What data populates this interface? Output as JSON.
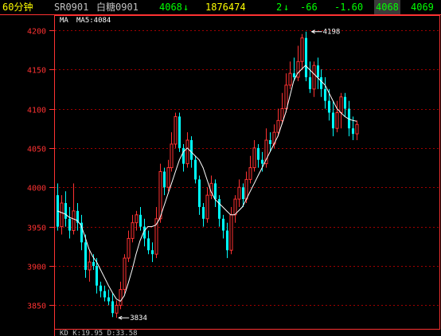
{
  "header": {
    "period": "60分钟",
    "contract_code": "SR0901",
    "contract_name": "白糖0901",
    "last_price": "4068",
    "last_arrow": "↓",
    "volume": "1876474",
    "tick_count": "2",
    "tick_arrow": "↓",
    "change": "-66",
    "change_pct": "-1.60",
    "bid": "4068",
    "ask": "4069"
  },
  "indicator_line": {
    "label": "MA",
    "ma5": "MA5:4084"
  },
  "bottom_indicator": {
    "text": "KD  K:19.95  D:33.58"
  },
  "colors": {
    "up": "#ff3232",
    "down": "#00ffff",
    "ma": "#ffffff",
    "axis": "#ff3232",
    "grid": "#a00000",
    "header_white": "#c0c0c0",
    "header_yellow": "#ffff00",
    "header_green": "#00ff00"
  },
  "chart_data": {
    "type": "candlestick",
    "yticks": [
      3850,
      3900,
      3950,
      4000,
      4050,
      4100,
      4150,
      4200
    ],
    "ylim": [
      3820,
      4218
    ],
    "annotations": [
      {
        "label": "4198",
        "value": 4198,
        "bar": 64
      },
      {
        "label": "3834",
        "value": 3834,
        "bar": 15
      }
    ],
    "candles": [
      [
        3990,
        3950,
        4005,
        3945
      ],
      [
        3950,
        3980,
        3990,
        3940
      ],
      [
        3980,
        3960,
        3995,
        3950
      ],
      [
        3960,
        3945,
        3975,
        3935
      ],
      [
        3945,
        3970,
        4005,
        3940
      ],
      [
        3970,
        3955,
        3980,
        3945
      ],
      [
        3955,
        3930,
        3965,
        3920
      ],
      [
        3930,
        3895,
        3940,
        3885
      ],
      [
        3895,
        3905,
        3920,
        3880
      ],
      [
        3905,
        3900,
        3915,
        3895
      ],
      [
        3900,
        3875,
        3910,
        3865
      ],
      [
        3875,
        3868,
        3880,
        3860
      ],
      [
        3868,
        3860,
        3875,
        3855
      ],
      [
        3860,
        3855,
        3870,
        3850
      ],
      [
        3855,
        3840,
        3865,
        3835
      ],
      [
        3840,
        3850,
        3856,
        3834
      ],
      [
        3850,
        3870,
        3880,
        3845
      ],
      [
        3870,
        3910,
        3915,
        3865
      ],
      [
        3910,
        3935,
        3945,
        3905
      ],
      [
        3935,
        3955,
        3965,
        3930
      ],
      [
        3955,
        3965,
        3970,
        3945
      ],
      [
        3965,
        3950,
        3975,
        3945
      ],
      [
        3950,
        3935,
        3960,
        3925
      ],
      [
        3935,
        3920,
        3945,
        3915
      ],
      [
        3920,
        3915,
        3930,
        3905
      ],
      [
        3915,
        3960,
        3975,
        3910
      ],
      [
        3960,
        4020,
        4030,
        3955
      ],
      [
        4020,
        4000,
        4025,
        3990
      ],
      [
        4000,
        4025,
        4035,
        3995
      ],
      [
        4025,
        4055,
        4070,
        4020
      ],
      [
        4055,
        4090,
        4095,
        4050
      ],
      [
        4090,
        4050,
        4095,
        4045
      ],
      [
        4050,
        4030,
        4055,
        4020
      ],
      [
        4030,
        4060,
        4070,
        4025
      ],
      [
        4060,
        4035,
        4065,
        4025
      ],
      [
        4035,
        4010,
        4040,
        4005
      ],
      [
        4010,
        3975,
        4015,
        3965
      ],
      [
        3975,
        3960,
        3980,
        3950
      ],
      [
        3960,
        3990,
        4000,
        3955
      ],
      [
        3990,
        4005,
        4015,
        3985
      ],
      [
        4005,
        3985,
        4010,
        3975
      ],
      [
        3985,
        3960,
        3990,
        3950
      ],
      [
        3960,
        3945,
        3965,
        3935
      ],
      [
        3945,
        3920,
        3955,
        3910
      ],
      [
        3920,
        3965,
        3975,
        3915
      ],
      [
        3965,
        3985,
        3990,
        3955
      ],
      [
        3985,
        4000,
        4010,
        3975
      ],
      [
        4000,
        3985,
        4005,
        3975
      ],
      [
        3985,
        4010,
        4020,
        3980
      ],
      [
        4010,
        4025,
        4040,
        4005
      ],
      [
        4025,
        4050,
        4060,
        4020
      ],
      [
        4050,
        4035,
        4055,
        4025
      ],
      [
        4035,
        4030,
        4045,
        4020
      ],
      [
        4030,
        4060,
        4075,
        4025
      ],
      [
        4060,
        4055,
        4070,
        4045
      ],
      [
        4055,
        4070,
        4080,
        4050
      ],
      [
        4070,
        4085,
        4100,
        4065
      ],
      [
        4085,
        4100,
        4120,
        4080
      ],
      [
        4100,
        4130,
        4145,
        4095
      ],
      [
        4130,
        4145,
        4160,
        4125
      ],
      [
        4145,
        4140,
        4165,
        4135
      ],
      [
        4140,
        4160,
        4180,
        4135
      ],
      [
        4160,
        4190,
        4195,
        4150
      ],
      [
        4190,
        4140,
        4198,
        4135
      ],
      [
        4140,
        4125,
        4160,
        4120
      ],
      [
        4125,
        4155,
        4160,
        4115
      ],
      [
        4155,
        4140,
        4165,
        4125
      ],
      [
        4140,
        4125,
        4150,
        4115
      ],
      [
        4125,
        4110,
        4140,
        4100
      ],
      [
        4110,
        4095,
        4125,
        4085
      ],
      [
        4095,
        4075,
        4110,
        4065
      ],
      [
        4075,
        4095,
        4110,
        4070
      ],
      [
        4095,
        4115,
        4120,
        4075
      ],
      [
        4115,
        4100,
        4120,
        4090
      ],
      [
        4100,
        4075,
        4110,
        4065
      ],
      [
        4075,
        4068,
        4090,
        4060
      ],
      [
        4068,
        4080,
        4085,
        4060
      ]
    ],
    "ma5": [
      3970,
      3968,
      3966,
      3962,
      3960,
      3958,
      3952,
      3938,
      3922,
      3912,
      3905,
      3895,
      3885,
      3875,
      3866,
      3858,
      3855,
      3862,
      3878,
      3895,
      3915,
      3932,
      3944,
      3950,
      3950,
      3952,
      3960,
      3975,
      3990,
      4005,
      4020,
      4035,
      4045,
      4050,
      4045,
      4040,
      4035,
      4025,
      4010,
      3995,
      3985,
      3980,
      3975,
      3970,
      3965,
      3965,
      3970,
      3975,
      3985,
      3995,
      4005,
      4015,
      4025,
      4035,
      4045,
      4055,
      4065,
      4080,
      4095,
      4115,
      4135,
      4145,
      4150,
      4155,
      4150,
      4145,
      4140,
      4135,
      4130,
      4120,
      4110,
      4100,
      4095,
      4090,
      4087,
      4085,
      4084
    ]
  }
}
